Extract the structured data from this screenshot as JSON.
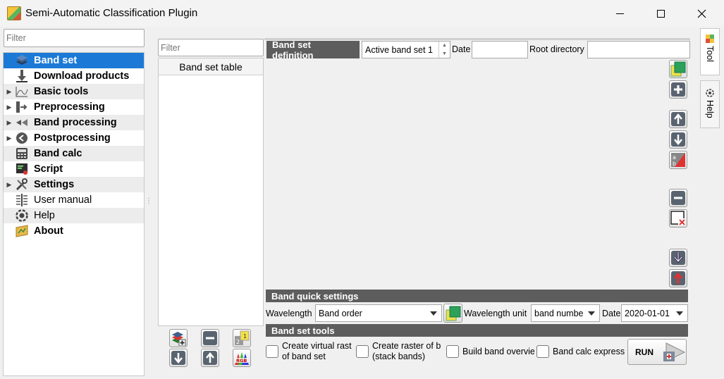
{
  "window": {
    "title": "Semi-Automatic Classification Plugin",
    "controls": {
      "minimize": "minimize",
      "maximize": "maximize",
      "close": "close"
    }
  },
  "sidebar": {
    "filter_placeholder": "Filter",
    "items": [
      {
        "label": "Band set",
        "bold": true,
        "expandable": false,
        "selected": true,
        "icon": "band-set-icon"
      },
      {
        "label": "Download products",
        "bold": true,
        "expandable": false,
        "icon": "download-icon"
      },
      {
        "label": "Basic tools",
        "bold": true,
        "expandable": true,
        "icon": "basic-tools-icon"
      },
      {
        "label": "Preprocessing",
        "bold": true,
        "expandable": true,
        "icon": "preprocessing-icon"
      },
      {
        "label": "Band processing",
        "bold": true,
        "expandable": true,
        "icon": "band-processing-icon"
      },
      {
        "label": "Postprocessing",
        "bold": true,
        "expandable": true,
        "icon": "postprocessing-icon"
      },
      {
        "label": "Band calc",
        "bold": true,
        "expandable": false,
        "icon": "calculator-icon"
      },
      {
        "label": "Script",
        "bold": true,
        "expandable": false,
        "icon": "script-icon"
      },
      {
        "label": "Settings",
        "bold": true,
        "expandable": true,
        "icon": "settings-icon"
      },
      {
        "label": "User manual",
        "bold": false,
        "expandable": false,
        "icon": "manual-icon"
      },
      {
        "label": "Help",
        "bold": false,
        "expandable": false,
        "icon": "help-icon"
      },
      {
        "label": "About",
        "bold": true,
        "expandable": false,
        "icon": "about-icon"
      }
    ]
  },
  "band_set_table": {
    "filter_placeholder": "Filter",
    "header": "Band set table"
  },
  "band_set_definition": {
    "section_label": "Band set definition",
    "active_band_set": "Active band set 1",
    "date_label": "Date",
    "date_value": "",
    "root_directory_label": "Root directory",
    "root_directory_value": ""
  },
  "band_quick_settings": {
    "section_label": "Band quick settings",
    "wavelength_label": "Wavelength",
    "wavelength_value": "Band order",
    "wavelength_unit_label": "Wavelength unit",
    "wavelength_unit_value": "band numbe",
    "date_label": "Date",
    "date_value": "2020-01-01"
  },
  "band_set_tools": {
    "section_label": "Band set tools",
    "options": [
      {
        "line1": "Create virtual rast",
        "line2": "of band set",
        "checked": false
      },
      {
        "line1": "Create raster of b",
        "line2": "(stack bands)",
        "checked": false
      },
      {
        "line1": "Build band overvie",
        "line2": "",
        "checked": false
      },
      {
        "line1": "Band calc express",
        "line2": "",
        "checked": false
      }
    ],
    "run_label": "RUN"
  },
  "side_tabs": {
    "tool": "Tool",
    "help": "Help"
  },
  "colors": {
    "selection": "#1c7ad6",
    "section_header": "#5d5d5d",
    "alt_row": "#ececec"
  }
}
